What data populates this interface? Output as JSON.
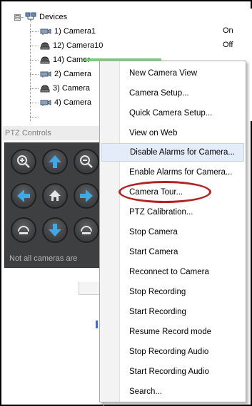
{
  "tree": {
    "root_label": "Devices",
    "expander": "⊟",
    "items": [
      {
        "label": "1) Camera1",
        "state": "On",
        "icon": "camera-box-icon"
      },
      {
        "label": "12) Camera10",
        "state": "Off",
        "icon": "dome-camera-icon"
      },
      {
        "label": "14) Camer",
        "state": "",
        "icon": "dome-camera-icon"
      },
      {
        "label": "2) Camera",
        "state": "",
        "icon": "camera-box-icon"
      },
      {
        "label": "3) Camera",
        "state": "",
        "icon": "dome-camera-icon"
      },
      {
        "label": "4) Camera",
        "state": "",
        "icon": "camera-box-icon"
      }
    ]
  },
  "ptz": {
    "title": "PTZ Controls",
    "note": "Not all cameras are",
    "buttons": [
      "zoom-in-icon",
      "arrow-up-icon",
      "zoom-out-icon",
      "arrow-left-icon",
      "home-icon",
      "arrow-right-icon",
      "focus-near-icon",
      "arrow-down-icon",
      "focus-far-icon"
    ]
  },
  "menu": {
    "items": [
      "New Camera View",
      "Camera Setup...",
      "Quick Camera Setup...",
      "View on Web",
      "Disable Alarms for Camera...",
      "Enable Alarms for Camera...",
      "Camera Tour...",
      "PTZ Calibration...",
      "Stop Camera",
      "Start Camera",
      "Reconnect to Camera",
      "Stop Recording",
      "Start Recording",
      "Resume Record mode",
      "Stop Recording Audio",
      "Start Recording Audio",
      "Search..."
    ],
    "highlighted_index": 4,
    "circled_index": 6
  },
  "colors": {
    "panel_bg": "#3d3f40",
    "ptz_button_icon": "#3fa9e6",
    "highlight_bg": "#e3ecf8",
    "annotation_oval": "#b22222",
    "selection_bar": "#7ec97e"
  }
}
